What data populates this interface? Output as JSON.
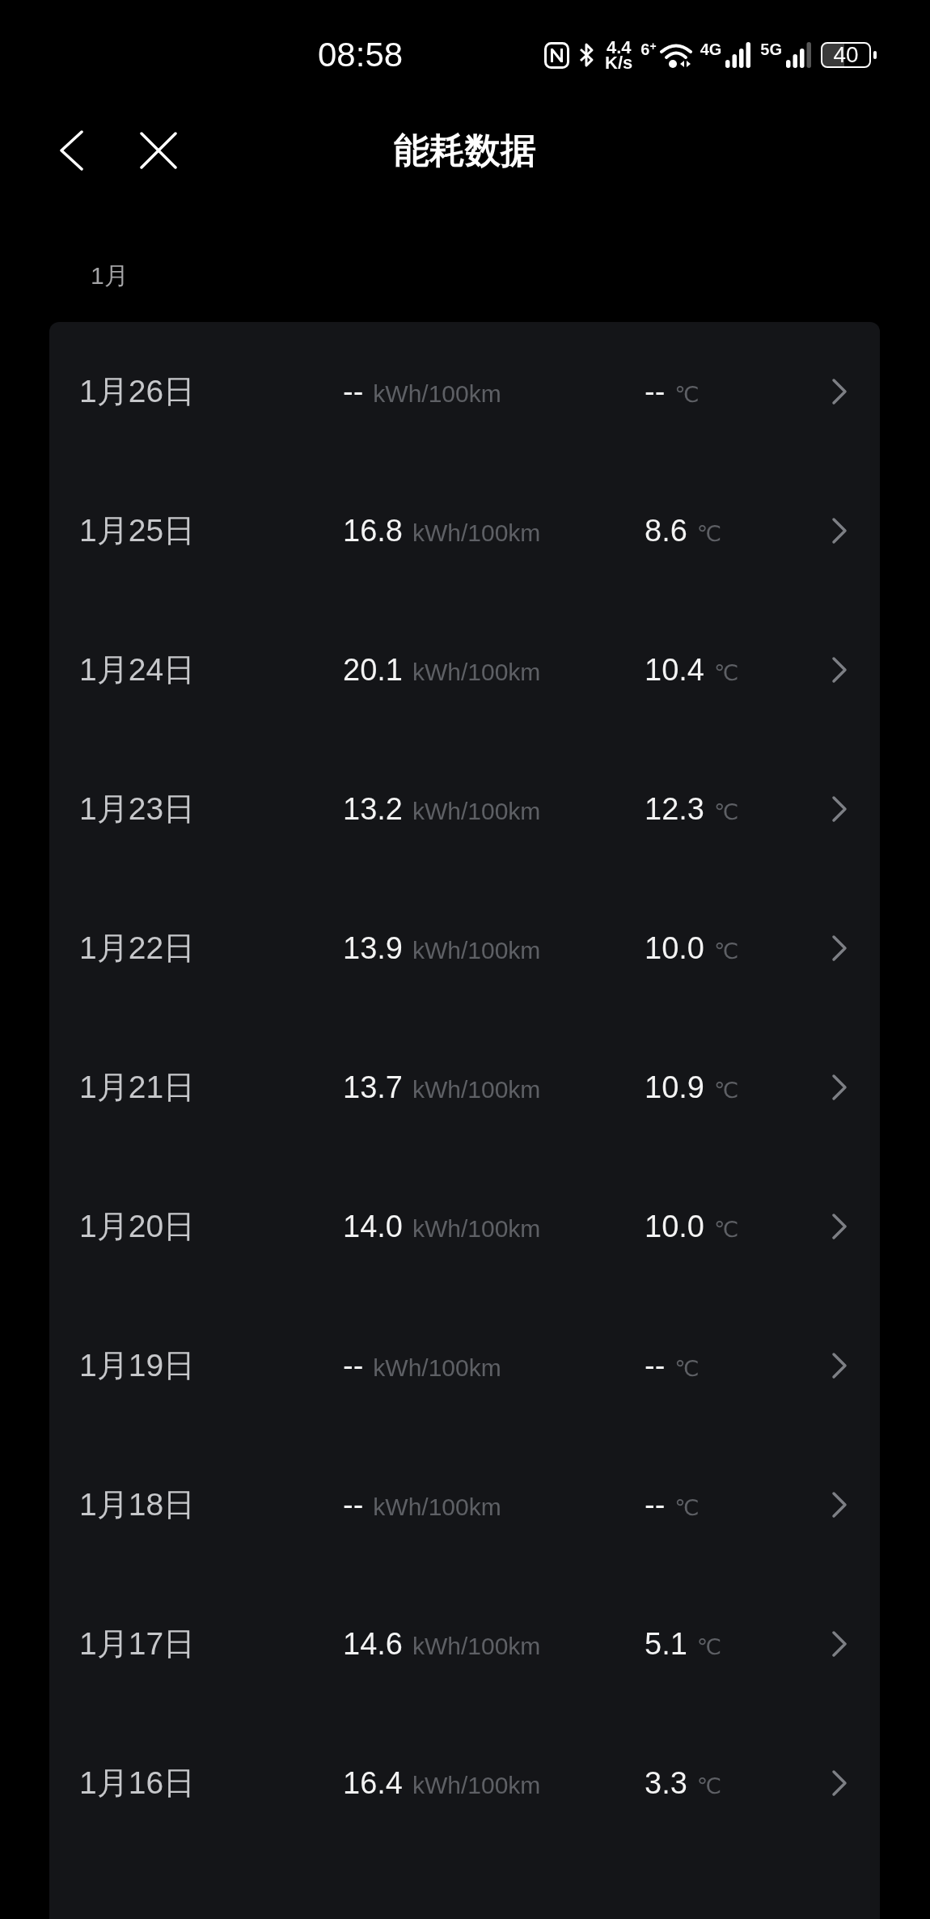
{
  "status_bar": {
    "time": "08:58",
    "network_speed": {
      "value": "4.4",
      "unit": "K/s"
    },
    "wifi": {
      "badge": "6$^{+}$"
    },
    "signals": [
      {
        "label": "4G"
      },
      {
        "label": "5G"
      }
    ],
    "battery": "40"
  },
  "header": {
    "title": "能耗数据"
  },
  "month": "1月",
  "days": [
    {
      "date": "1月26日",
      "consumption": "--",
      "consumption_unit": "kWh/100km",
      "temperature": "--",
      "temperature_unit": "℃"
    },
    {
      "date": "1月25日",
      "consumption": "16.8",
      "consumption_unit": "kWh/100km",
      "temperature": "8.6",
      "temperature_unit": "℃"
    },
    {
      "date": "1月24日",
      "consumption": "20.1",
      "consumption_unit": "kWh/100km",
      "temperature": "10.4",
      "temperature_unit": "℃"
    },
    {
      "date": "1月23日",
      "consumption": "13.2",
      "consumption_unit": "kWh/100km",
      "temperature": "12.3",
      "temperature_unit": "℃"
    },
    {
      "date": "1月22日",
      "consumption": "13.9",
      "consumption_unit": "kWh/100km",
      "temperature": "10.0",
      "temperature_unit": "℃"
    },
    {
      "date": "1月21日",
      "consumption": "13.7",
      "consumption_unit": "kWh/100km",
      "temperature": "10.9",
      "temperature_unit": "℃"
    },
    {
      "date": "1月20日",
      "consumption": "14.0",
      "consumption_unit": "kWh/100km",
      "temperature": "10.0",
      "temperature_unit": "℃"
    },
    {
      "date": "1月19日",
      "consumption": "--",
      "consumption_unit": "kWh/100km",
      "temperature": "--",
      "temperature_unit": "℃"
    },
    {
      "date": "1月18日",
      "consumption": "--",
      "consumption_unit": "kWh/100km",
      "temperature": "--",
      "temperature_unit": "℃"
    },
    {
      "date": "1月17日",
      "consumption": "14.6",
      "consumption_unit": "kWh/100km",
      "temperature": "5.1",
      "temperature_unit": "℃"
    },
    {
      "date": "1月16日",
      "consumption": "16.4",
      "consumption_unit": "kWh/100km",
      "temperature": "3.3",
      "temperature_unit": "℃"
    }
  ]
}
